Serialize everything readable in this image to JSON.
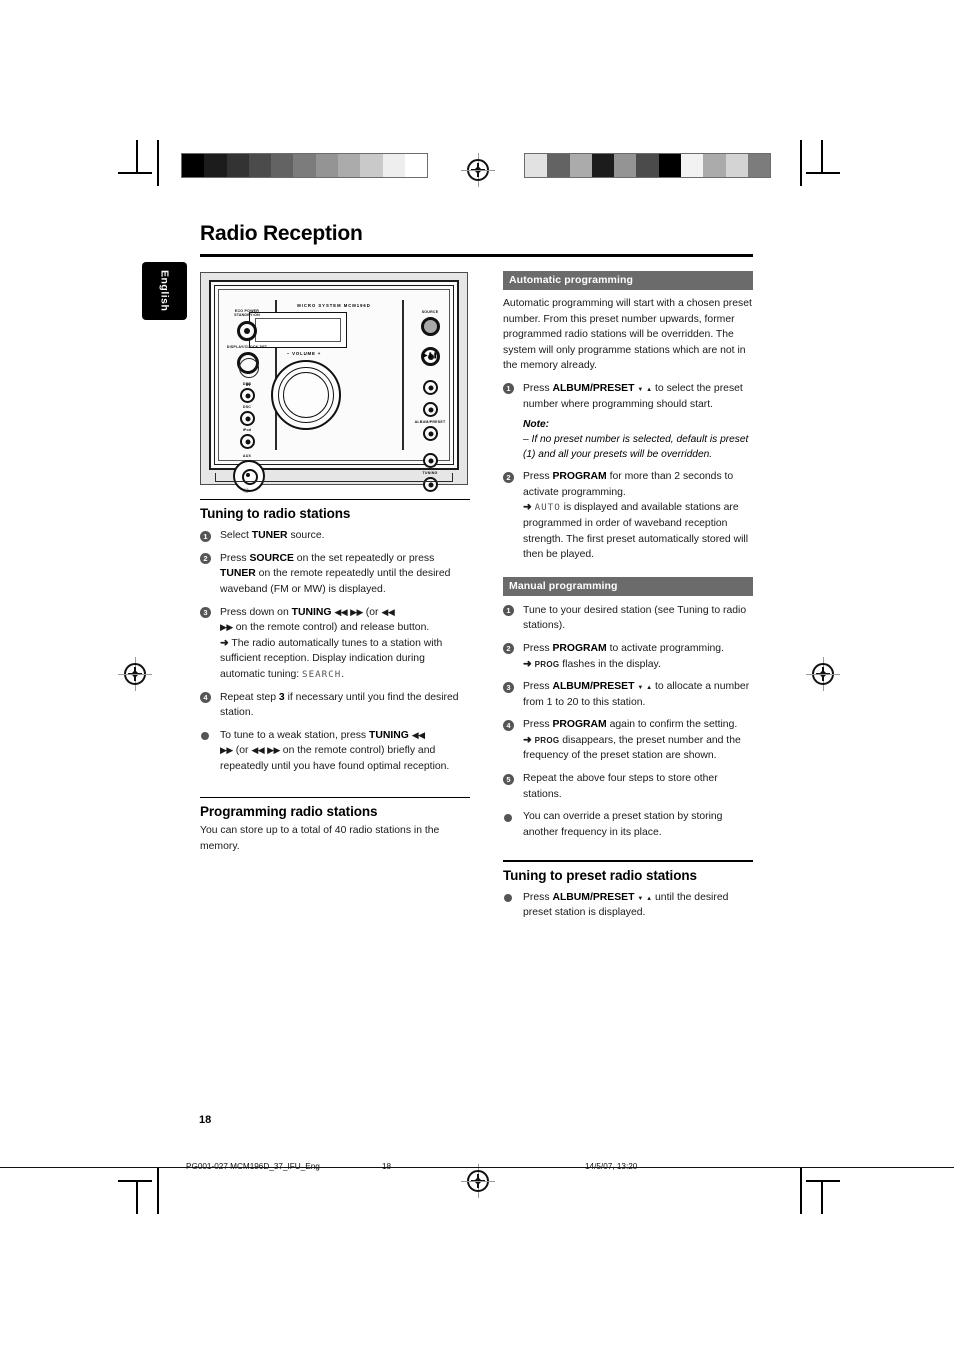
{
  "document": {
    "title": "Radio Reception",
    "language_tab": "English",
    "page_number": "18",
    "footer": {
      "file": "PG001-027 MCM196D_37_IFU_Eng",
      "page": "18",
      "timestamp": "14/5/07, 13:20"
    }
  },
  "calibration": {
    "left_bar": [
      "#000000",
      "#1c1c1c",
      "#333333",
      "#4b4b4b",
      "#636363",
      "#7c7c7c",
      "#949494",
      "#ababab",
      "#c9c9c9",
      "#eeeeee",
      "#ffffff"
    ],
    "right_bar": [
      "#e2e2e2",
      "#636363",
      "#ababab",
      "#1c1c1c",
      "#949494",
      "#4b4b4b",
      "#000000",
      "#f2f2f2",
      "#ababab",
      "#d4d4d4",
      "#7c7c7c"
    ]
  },
  "figure": {
    "name": "micro-system-front-panel",
    "display_caption": "MICRO SYSTEM MCM196D",
    "volume_label": "–  VOLUME  +",
    "ir_label": "IR",
    "left_controls": [
      {
        "label": "ECO POWER\nSTANDBY•ON"
      },
      {
        "label": "DISPLAY/CLOCK SET"
      },
      {
        "label": "DBB"
      },
      {
        "label": "DSC"
      },
      {
        "label": "iPod"
      },
      {
        "label": "AUX"
      }
    ],
    "right_controls": [
      {
        "label": "SOURCE"
      },
      {
        "label": "ALBUM/PRESET"
      },
      {
        "label": "TUNING"
      }
    ]
  },
  "left_column": {
    "section1": {
      "heading": "Tuning to radio stations",
      "steps": [
        {
          "marker": "1",
          "type": "number",
          "html": "Select <b>TUNER</b> source."
        },
        {
          "marker": "2",
          "type": "number",
          "html": "Press <b>SOURCE</b> on the set repeatedly or press <b>TUNER</b> on the remote repeatedly until the desired waveband (FM or MW) is displayed."
        },
        {
          "marker": "3",
          "type": "number",
          "html": "Press down on <b>TUNING</b> <span class=\"nav-glyph\">◀◀</span> <span class=\"nav-glyph\">▶▶</span> (or <span class=\"nav-glyph\">◀◀</span><br><span class=\"nav-glyph\">▶▶</span> on the remote control) and release button.<br><span class=\"arrow\">➜</span> The radio automatically tunes to a station with sufficient reception. Display indication during automatic tuning: <span class=\"lcdtxt\">SEARCH</span>."
        },
        {
          "marker": "4",
          "type": "number",
          "html": "Repeat step <b>3</b> if necessary until you find the desired station."
        },
        {
          "marker": "•",
          "type": "bullet",
          "html": "To tune to a weak station, press <b>TUNING</b> <span class=\"nav-glyph\">◀◀</span><br><span class=\"nav-glyph\">▶▶</span> (or <span class=\"nav-glyph\">◀◀</span> <span class=\"nav-glyph\">▶▶</span> on the remote control) briefly and repeatedly until you have found optimal reception."
        }
      ]
    },
    "section2": {
      "heading": "Programming radio stations",
      "body": "You can store up to a total of 40 radio stations in the memory."
    }
  },
  "right_column": {
    "section_auto": {
      "band_title": "Automatic programming",
      "intro": "Automatic programming will start with a chosen preset number. From this preset number upwards, former programmed radio stations will be overridden. The system will only programme stations which are not in the memory already.",
      "steps": [
        {
          "marker": "1",
          "type": "number",
          "html": "Press <b>ALBUM/PRESET</b> <span class=\"tri\">▼</span> <span class=\"tri\">▲</span> to select the preset number where programming should start."
        },
        {
          "marker": "2",
          "type": "number",
          "html": "Press <b>PROGRAM</b> for more than 2 seconds to activate programming.<br><span class=\"arrow\">➜</span> <span class=\"lcdtxt\">AUTO</span> is displayed and available stations are programmed in order of waveband reception strength. The first preset automatically stored will then be played."
        }
      ],
      "note_title": "Note:",
      "note_body": "–  If no preset number is selected, default is preset (1) and all your presets will be overridden."
    },
    "section_manual": {
      "band_title": "Manual programming",
      "steps": [
        {
          "marker": "1",
          "type": "number",
          "html": "Tune to your desired station (see Tuning to radio stations)."
        },
        {
          "marker": "2",
          "type": "number",
          "html": "Press <b>PROGRAM</b> to activate programming.<br><span class=\"arrow\">➜</span> <span class=\"smallcaps-prog\">PROG</span> flashes in the display."
        },
        {
          "marker": "3",
          "type": "number",
          "html": "Press <b>ALBUM/PRESET</b> <span class=\"tri\">▼</span> <span class=\"tri\">▲</span> to allocate a number from 1 to 20 to this station."
        },
        {
          "marker": "4",
          "type": "number",
          "html": "Press <b>PROGRAM</b> again to confirm the setting.<br><span class=\"arrow\">➜</span> <span class=\"smallcaps-prog\">PROG</span> disappears, the preset number and the frequency of the preset station are shown."
        },
        {
          "marker": "5",
          "type": "number",
          "html": "Repeat the above four steps to store other stations."
        },
        {
          "marker": "•",
          "type": "bullet",
          "html": "You can override a preset station by storing another frequency in its place."
        }
      ]
    },
    "section_preset": {
      "heading": "Tuning to preset radio stations",
      "steps": [
        {
          "marker": "•",
          "type": "bullet",
          "html": "Press <b>ALBUM/PRESET</b> <span class=\"tri\">▼</span> <span class=\"tri\">▲</span> until the desired preset station is displayed."
        }
      ]
    }
  }
}
